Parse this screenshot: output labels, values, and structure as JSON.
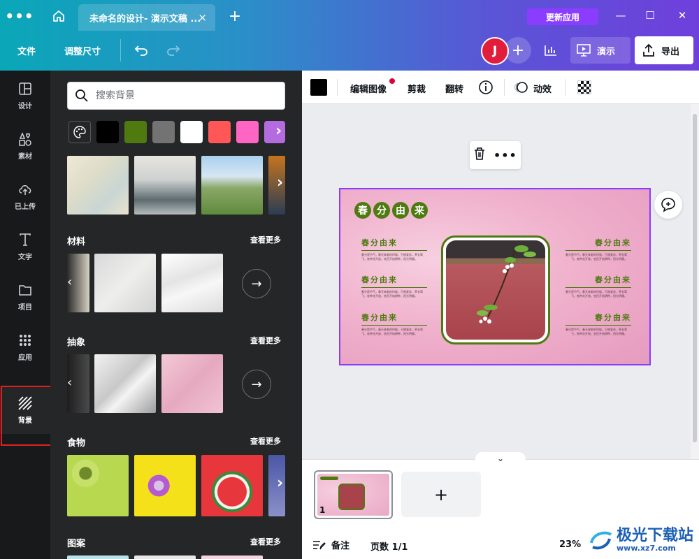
{
  "app": {
    "tab_title": "未命名的设计- 演示文稿 ...",
    "update_button": "更新应用",
    "tab_close": "×",
    "new_tab": "+"
  },
  "toolbar": {
    "file": "文件",
    "resize": "调整尺寸",
    "avatar_initial": "J",
    "add_member": "+",
    "present": "演示",
    "export": "导出"
  },
  "rail": {
    "items": [
      {
        "label": "设计",
        "icon": "layout-icon"
      },
      {
        "label": "素材",
        "icon": "shapes-icon"
      },
      {
        "label": "已上传",
        "icon": "cloud-upload-icon"
      },
      {
        "label": "文字",
        "icon": "text-icon"
      },
      {
        "label": "项目",
        "icon": "folder-icon"
      },
      {
        "label": "应用",
        "icon": "apps-grid-icon"
      },
      {
        "label": "背景",
        "icon": "background-stripes-icon"
      }
    ],
    "active": "背景"
  },
  "panel": {
    "search_placeholder": "搜索背景",
    "swatch_colors": [
      "#000000",
      "#4e7a10",
      "#737373",
      "#ffffff",
      "#ff5757",
      "#ff66c4",
      "#b56be0"
    ],
    "sections": [
      {
        "title": "材料",
        "see_more": "查看更多"
      },
      {
        "title": "抽象",
        "see_more": "查看更多"
      },
      {
        "title": "食物",
        "see_more": "查看更多"
      },
      {
        "title": "图案",
        "see_more": "查看更多"
      }
    ]
  },
  "context_bar": {
    "edit_image": "编辑图像",
    "crop": "剪裁",
    "flip": "翻转",
    "animate": "动效",
    "color": "#000000"
  },
  "slide": {
    "title_chars": [
      "春",
      "分",
      "由",
      "来"
    ],
    "block_heading": "春分由来",
    "block_text": "春分是节气，春天来临的时候，万物复苏，草长莺飞，各种花开放，农民开始耕种，阳光明媚。",
    "accent": "#4e7a10"
  },
  "bottom": {
    "notes": "备注",
    "page_count": "页数 1/1",
    "zoom": "23%",
    "page_number": "1",
    "add_page": "+",
    "pages_toggle": "⌄"
  },
  "watermark": {
    "text": "极光下载站",
    "url": "www.xz7.com"
  },
  "colors": {
    "accent_purple": "#8b3dff",
    "avatar_red": "#e01e3c",
    "rail_bg": "#18191b",
    "panel_bg": "#252627"
  }
}
